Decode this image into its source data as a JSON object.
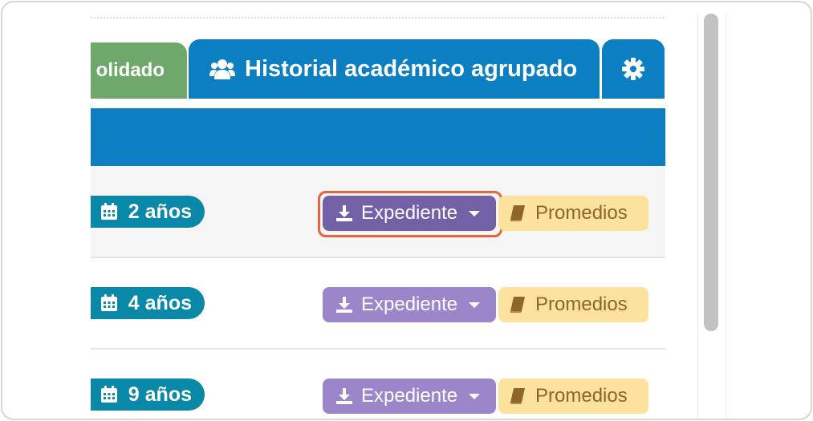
{
  "tabs": {
    "consolidated_label": "olidado",
    "grouped_label": "Historial académico agrupado",
    "settings_icon": "gear-icon"
  },
  "rows": [
    {
      "years": "2 años",
      "expediente": "Expediente",
      "promedios": "Promedios",
      "focused": true
    },
    {
      "years": "4 años",
      "expediente": "Expediente",
      "promedios": "Promedios",
      "focused": false
    },
    {
      "years": "9 años",
      "expediente": "Expediente",
      "promedios": "Promedios",
      "focused": false
    }
  ],
  "colors": {
    "tab_green": "#6ea86a",
    "tab_blue": "#0b7fc1",
    "years_badge": "#0a88a8",
    "expediente_active": "#7361a8",
    "expediente": "#9a86c9",
    "promedios": "#fce29c",
    "focus_ring": "#e8643c"
  }
}
